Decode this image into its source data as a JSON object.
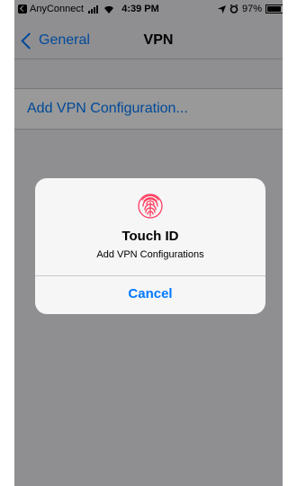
{
  "status_bar": {
    "back_app": "AnyConnect",
    "time": "4:39 PM",
    "battery": "97%"
  },
  "nav": {
    "back_label": "General",
    "title": "VPN"
  },
  "list": {
    "add_config_label": "Add VPN Configuration..."
  },
  "alert": {
    "icon": "fingerprint-icon",
    "title": "Touch ID",
    "message": "Add VPN Configurations",
    "cancel_label": "Cancel"
  },
  "colors": {
    "accent": "#007aff",
    "fingerprint": "#ff3b5c"
  }
}
